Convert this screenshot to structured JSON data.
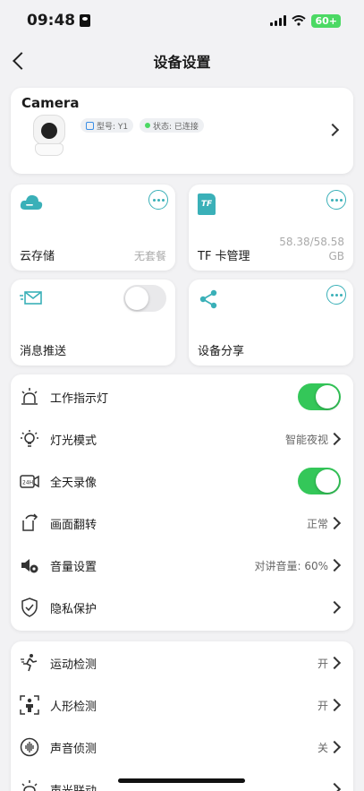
{
  "status_bar": {
    "time": "09:48",
    "battery": "60+"
  },
  "nav": {
    "title": "设备设置"
  },
  "camera": {
    "name": "Camera",
    "model": "型号: Y1",
    "state": "状态: 已连接"
  },
  "tiles": {
    "cloud": {
      "label": "云存储",
      "value": "无套餐"
    },
    "tf": {
      "icon_text": "TF",
      "label": "TF 卡管理",
      "value_line1": "58.38/58.58",
      "value_line2": "GB"
    },
    "push": {
      "label": "消息推送",
      "toggle": "off"
    },
    "share": {
      "label": "设备分享"
    }
  },
  "settings": [
    {
      "icon": "alarm-light-icon",
      "label": "工作指示灯",
      "value": "",
      "control": "toggle-on"
    },
    {
      "icon": "bulb-icon",
      "label": "灯光模式",
      "value": "智能夜视",
      "control": "chevron"
    },
    {
      "icon": "24h-record-icon",
      "label": "全天录像",
      "value": "",
      "control": "toggle-on"
    },
    {
      "icon": "flip-icon",
      "label": "画面翻转",
      "value": "正常",
      "control": "chevron"
    },
    {
      "icon": "volume-settings-icon",
      "label": "音量设置",
      "value": "对讲音量: 60%",
      "control": "chevron"
    },
    {
      "icon": "shield-check-icon",
      "label": "隐私保护",
      "value": "",
      "control": "chevron"
    }
  ],
  "detection": [
    {
      "icon": "running-person-icon",
      "label": "运动检测",
      "value": "开"
    },
    {
      "icon": "human-shape-icon",
      "label": "人形检测",
      "value": "开"
    },
    {
      "icon": "sound-wave-icon",
      "label": "声音侦测",
      "value": "关"
    },
    {
      "icon": "sound-light-icon",
      "label": "声光联动",
      "value": ""
    }
  ],
  "colors": {
    "accent": "#3ab0b8",
    "toggle_on": "#34c759",
    "background": "#f2f2f4"
  }
}
